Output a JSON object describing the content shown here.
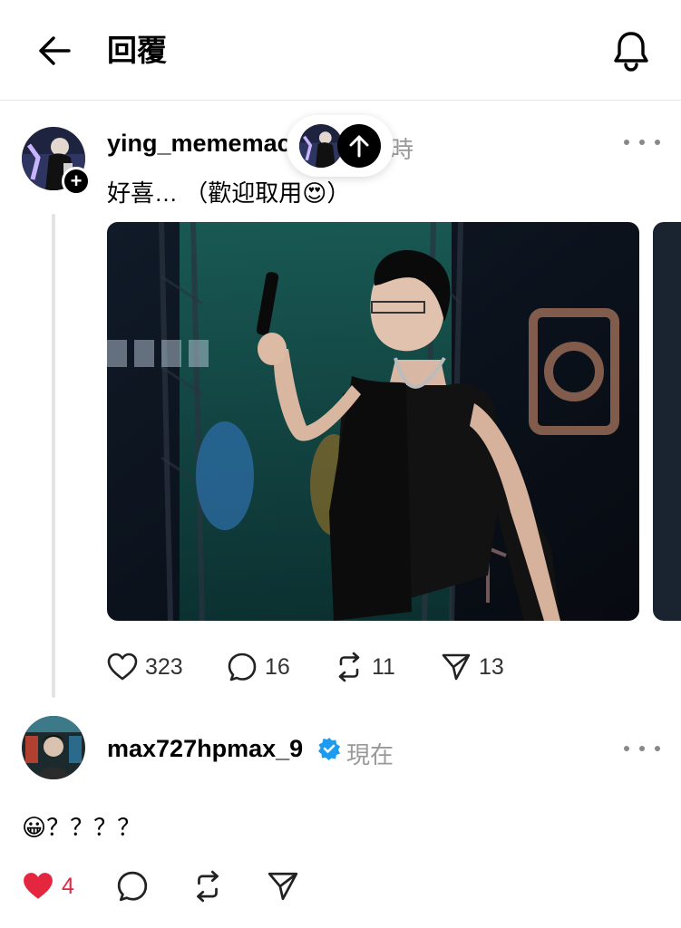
{
  "header": {
    "title": "回覆"
  },
  "post": {
    "username": "ying_mememac",
    "time": "時",
    "text": "好喜… （歡迎取用😍）",
    "actions": {
      "likes": "323",
      "replies": "16",
      "reposts": "11",
      "shares": "13"
    }
  },
  "reply": {
    "username": "max727hpmax_9",
    "verified": true,
    "time": "現在",
    "text": "😀？？？？",
    "actions": {
      "likes": "4"
    }
  },
  "colors": {
    "like_active": "#e5263f",
    "verified_badge": "#1d9bf0",
    "muted": "#999999"
  }
}
